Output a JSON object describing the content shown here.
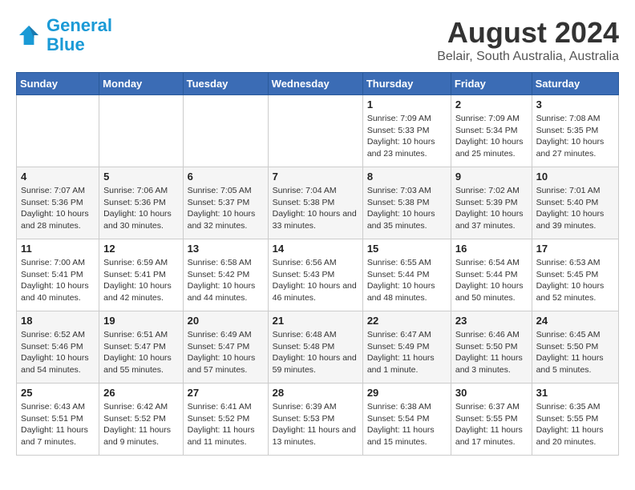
{
  "header": {
    "logo_line1": "General",
    "logo_line2": "Blue",
    "title": "August 2024",
    "subtitle": "Belair, South Australia, Australia"
  },
  "days_of_week": [
    "Sunday",
    "Monday",
    "Tuesday",
    "Wednesday",
    "Thursday",
    "Friday",
    "Saturday"
  ],
  "weeks": [
    [
      {
        "day": "",
        "info": ""
      },
      {
        "day": "",
        "info": ""
      },
      {
        "day": "",
        "info": ""
      },
      {
        "day": "",
        "info": ""
      },
      {
        "day": "1",
        "info": "Sunrise: 7:09 AM\nSunset: 5:33 PM\nDaylight: 10 hours and 23 minutes."
      },
      {
        "day": "2",
        "info": "Sunrise: 7:09 AM\nSunset: 5:34 PM\nDaylight: 10 hours and 25 minutes."
      },
      {
        "day": "3",
        "info": "Sunrise: 7:08 AM\nSunset: 5:35 PM\nDaylight: 10 hours and 27 minutes."
      }
    ],
    [
      {
        "day": "4",
        "info": "Sunrise: 7:07 AM\nSunset: 5:36 PM\nDaylight: 10 hours and 28 minutes."
      },
      {
        "day": "5",
        "info": "Sunrise: 7:06 AM\nSunset: 5:36 PM\nDaylight: 10 hours and 30 minutes."
      },
      {
        "day": "6",
        "info": "Sunrise: 7:05 AM\nSunset: 5:37 PM\nDaylight: 10 hours and 32 minutes."
      },
      {
        "day": "7",
        "info": "Sunrise: 7:04 AM\nSunset: 5:38 PM\nDaylight: 10 hours and 33 minutes."
      },
      {
        "day": "8",
        "info": "Sunrise: 7:03 AM\nSunset: 5:38 PM\nDaylight: 10 hours and 35 minutes."
      },
      {
        "day": "9",
        "info": "Sunrise: 7:02 AM\nSunset: 5:39 PM\nDaylight: 10 hours and 37 minutes."
      },
      {
        "day": "10",
        "info": "Sunrise: 7:01 AM\nSunset: 5:40 PM\nDaylight: 10 hours and 39 minutes."
      }
    ],
    [
      {
        "day": "11",
        "info": "Sunrise: 7:00 AM\nSunset: 5:41 PM\nDaylight: 10 hours and 40 minutes."
      },
      {
        "day": "12",
        "info": "Sunrise: 6:59 AM\nSunset: 5:41 PM\nDaylight: 10 hours and 42 minutes."
      },
      {
        "day": "13",
        "info": "Sunrise: 6:58 AM\nSunset: 5:42 PM\nDaylight: 10 hours and 44 minutes."
      },
      {
        "day": "14",
        "info": "Sunrise: 6:56 AM\nSunset: 5:43 PM\nDaylight: 10 hours and 46 minutes."
      },
      {
        "day": "15",
        "info": "Sunrise: 6:55 AM\nSunset: 5:44 PM\nDaylight: 10 hours and 48 minutes."
      },
      {
        "day": "16",
        "info": "Sunrise: 6:54 AM\nSunset: 5:44 PM\nDaylight: 10 hours and 50 minutes."
      },
      {
        "day": "17",
        "info": "Sunrise: 6:53 AM\nSunset: 5:45 PM\nDaylight: 10 hours and 52 minutes."
      }
    ],
    [
      {
        "day": "18",
        "info": "Sunrise: 6:52 AM\nSunset: 5:46 PM\nDaylight: 10 hours and 54 minutes."
      },
      {
        "day": "19",
        "info": "Sunrise: 6:51 AM\nSunset: 5:47 PM\nDaylight: 10 hours and 55 minutes."
      },
      {
        "day": "20",
        "info": "Sunrise: 6:49 AM\nSunset: 5:47 PM\nDaylight: 10 hours and 57 minutes."
      },
      {
        "day": "21",
        "info": "Sunrise: 6:48 AM\nSunset: 5:48 PM\nDaylight: 10 hours and 59 minutes."
      },
      {
        "day": "22",
        "info": "Sunrise: 6:47 AM\nSunset: 5:49 PM\nDaylight: 11 hours and 1 minute."
      },
      {
        "day": "23",
        "info": "Sunrise: 6:46 AM\nSunset: 5:50 PM\nDaylight: 11 hours and 3 minutes."
      },
      {
        "day": "24",
        "info": "Sunrise: 6:45 AM\nSunset: 5:50 PM\nDaylight: 11 hours and 5 minutes."
      }
    ],
    [
      {
        "day": "25",
        "info": "Sunrise: 6:43 AM\nSunset: 5:51 PM\nDaylight: 11 hours and 7 minutes."
      },
      {
        "day": "26",
        "info": "Sunrise: 6:42 AM\nSunset: 5:52 PM\nDaylight: 11 hours and 9 minutes."
      },
      {
        "day": "27",
        "info": "Sunrise: 6:41 AM\nSunset: 5:52 PM\nDaylight: 11 hours and 11 minutes."
      },
      {
        "day": "28",
        "info": "Sunrise: 6:39 AM\nSunset: 5:53 PM\nDaylight: 11 hours and 13 minutes."
      },
      {
        "day": "29",
        "info": "Sunrise: 6:38 AM\nSunset: 5:54 PM\nDaylight: 11 hours and 15 minutes."
      },
      {
        "day": "30",
        "info": "Sunrise: 6:37 AM\nSunset: 5:55 PM\nDaylight: 11 hours and 17 minutes."
      },
      {
        "day": "31",
        "info": "Sunrise: 6:35 AM\nSunset: 5:55 PM\nDaylight: 11 hours and 20 minutes."
      }
    ]
  ]
}
